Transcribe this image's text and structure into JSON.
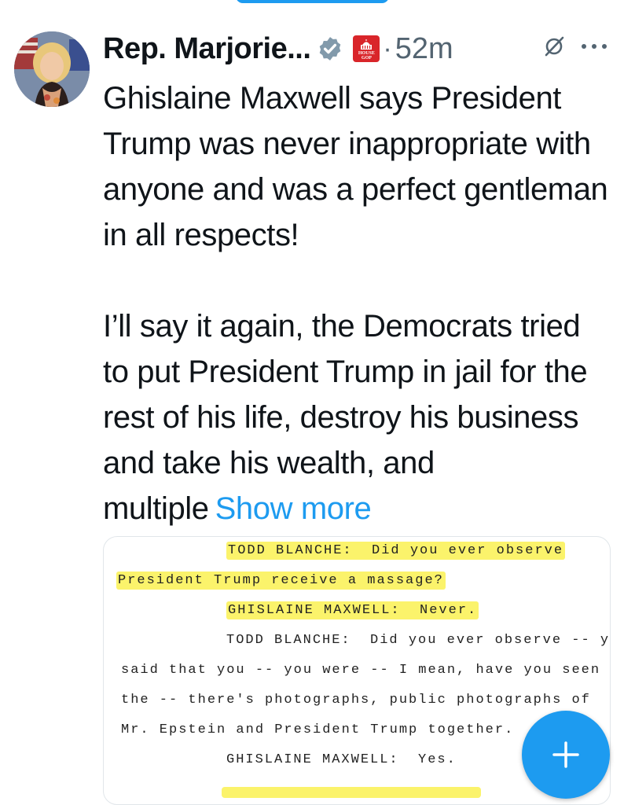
{
  "post": {
    "author_name": "Rep. Marjorie...",
    "badge_lines": [
      "HOUSE",
      "GOP"
    ],
    "separator": "·",
    "timestamp": "52m",
    "text": "Ghislaine Maxwell says President Trump was never inappropriate with anyone and was a perfect gentleman in all respects!\n\nI’ll say it again, the Democrats tried to put President Trump in jail for the rest of his life, destroy his business and take his wealth, and multiple",
    "show_more_label": "Show more"
  },
  "transcript": {
    "lines": [
      "TODD BLANCHE:  Did you ever observe",
      "President Trump receive a massage?",
      "GHISLAINE MAXWELL:  Never.",
      "TODD BLANCHE:  Did you ever observe -- y",
      "said that you -- you were -- I mean, have you seen",
      "the -- there's photographs, public photographs of",
      "Mr. Epstein and President Trump together.",
      "GHISLAINE MAXWELL:  Yes."
    ],
    "highlighted_line_indices": [
      0,
      1,
      2
    ],
    "highlight_color": "#fbf36b"
  },
  "colors": {
    "accent": "#1d9bf0",
    "text_primary": "#0f1419",
    "text_secondary": "#536471",
    "verified_badge": "#829aab",
    "gop_badge": "#d9252a"
  },
  "icons": {
    "verified": "verified-badge-icon",
    "affiliate": "house-gop-badge-icon",
    "grok": "grok-icon",
    "more": "more-options-icon",
    "compose": "plus-icon"
  }
}
